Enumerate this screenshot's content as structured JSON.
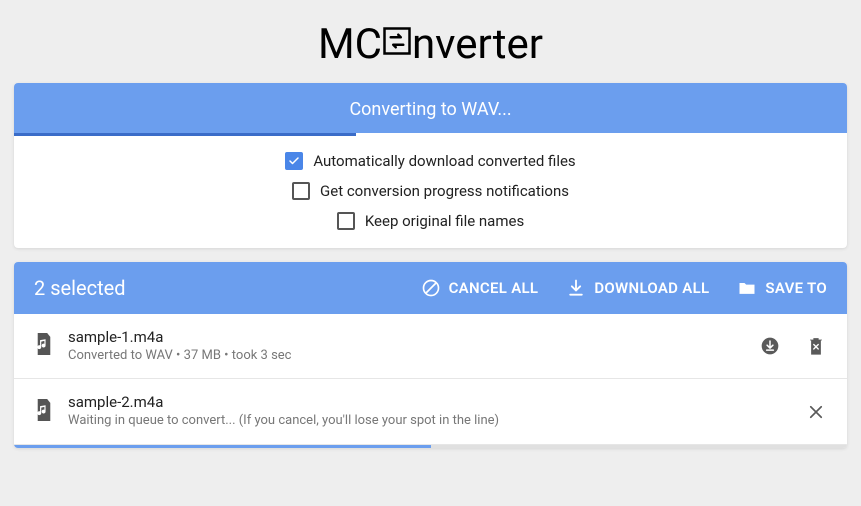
{
  "logo": {
    "prefix": "MC",
    "suffix": "nverter"
  },
  "convert_panel": {
    "title": "Converting to WAV...",
    "progress_percent": 41,
    "options": [
      {
        "label": "Automatically download converted files",
        "checked": true
      },
      {
        "label": "Get conversion progress notifications",
        "checked": false
      },
      {
        "label": "Keep original file names",
        "checked": false
      }
    ]
  },
  "files_panel": {
    "selected_text": "2 selected",
    "buttons": {
      "cancel_all": "CANCEL ALL",
      "download_all": "DOWNLOAD ALL",
      "save_to": "SAVE TO"
    },
    "files": [
      {
        "name": "sample-1.m4a",
        "status": "Converted to WAV • 37 MB • took 3 sec",
        "actions": [
          "download",
          "delete"
        ]
      },
      {
        "name": "sample-2.m4a",
        "status": "Waiting in queue to convert... (If you cancel, you'll lose your spot in the line)",
        "actions": [
          "cancel"
        ]
      }
    ],
    "bottom_progress_percent": 50
  }
}
